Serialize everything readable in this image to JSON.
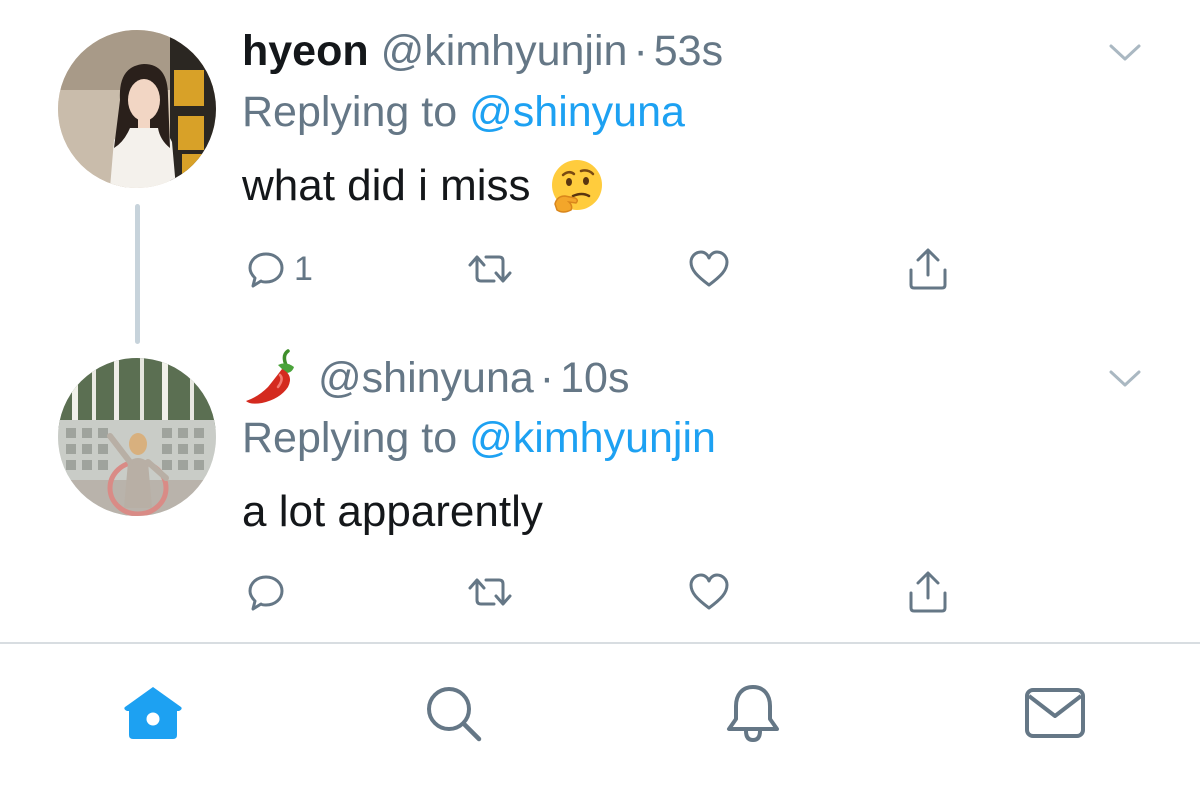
{
  "colors": {
    "text_primary": "#14171a",
    "text_secondary": "#657786",
    "accent": "#1da1f2",
    "thread_line": "#c7d3db",
    "divider": "#d8dde1"
  },
  "tweets": [
    {
      "display_name": "hyeon",
      "handle": "@kimhyunjin",
      "separator": "·",
      "time": "53s",
      "replying_label": "Replying to",
      "replying_to": "@shinyuna",
      "text": "what did i miss",
      "emoji": "thinking-face",
      "reply_count": "1",
      "avatar": "avatar-hyeon"
    },
    {
      "display_name_emoji": "hot-pepper",
      "handle": "@shinyuna",
      "separator": "·",
      "time": "10s",
      "replying_label": "Replying to",
      "replying_to": "@kimhyunjin",
      "text": "a lot apparently",
      "reply_count": "",
      "avatar": "avatar-shinyuna"
    }
  ],
  "actions": [
    "reply-icon",
    "retweet-icon",
    "like-icon",
    "share-icon"
  ],
  "tabbar": {
    "items": [
      "home-icon",
      "search-icon",
      "notifications-icon",
      "messages-icon"
    ],
    "active": "home-icon"
  }
}
